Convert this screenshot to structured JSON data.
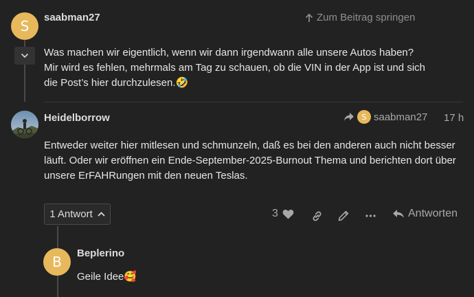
{
  "post1": {
    "avatar_letter": "S",
    "avatar_color": "#e8b85c",
    "username": "saabman27",
    "jump_label": "Zum Beitrag springen",
    "lines": [
      "Was machen wir eigentlich, wenn wir dann irgendwann alle unsere Autos haben?",
      "Mir wird es fehlen, mehrmals am Tag zu schauen, ob die VIN in der App ist und sich",
      "die Post’s hier durchzulesen.🤣"
    ]
  },
  "post2": {
    "username": "Heidelborrow",
    "reply_to": {
      "avatar_letter": "S",
      "username": "saabman27"
    },
    "time": "17 h",
    "lines": [
      "Entweder weiter hier mitlesen und schmunzeln, daß es bei den anderen auch nicht besser",
      "läuft. Oder wir eröffnen ein Ende-September-2025-Burnout Thema und berichten dort über",
      "unsere ErFAHRungen mit den neuen Teslas."
    ],
    "replies_button": "1 Antwort",
    "like_count": "3",
    "reply_label": "Antworten"
  },
  "post3": {
    "avatar_letter": "B",
    "avatar_color": "#e8b85c",
    "username": "Beplerino",
    "text": "Geile Idee🥰"
  }
}
